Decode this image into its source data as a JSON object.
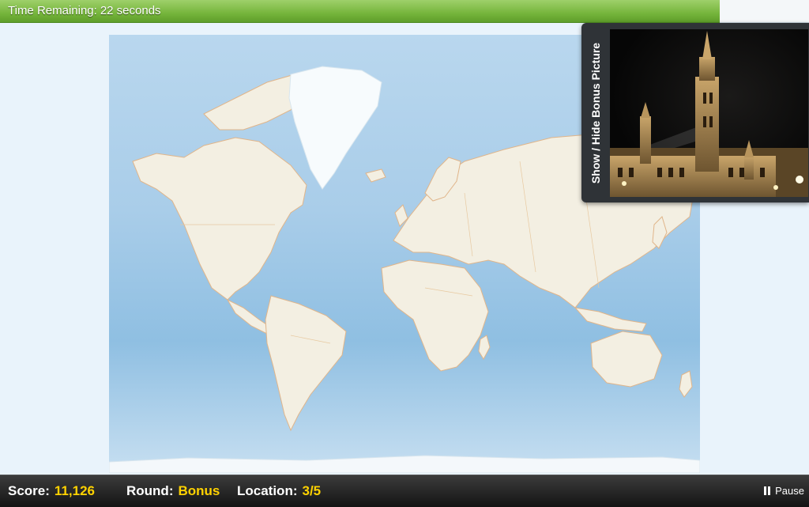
{
  "timer": {
    "label": "Time Remaining:",
    "value": "22 seconds",
    "progress_fraction": 0.89
  },
  "bonus": {
    "toggle_label": "Show / Hide Bonus Picture",
    "photo_icon": "gothic-town-hall-night-photo"
  },
  "status": {
    "score_label": "Score:",
    "score_value": "11,126",
    "round_label": "Round:",
    "round_value": "Bonus",
    "location_label": "Location:",
    "location_value": "3/5",
    "pause_label": "Pause"
  },
  "colors": {
    "timer_fill": "#76b53c",
    "highlight_value": "#ffd200",
    "ocean": "#a9cde9",
    "land": "#f3efe2"
  }
}
